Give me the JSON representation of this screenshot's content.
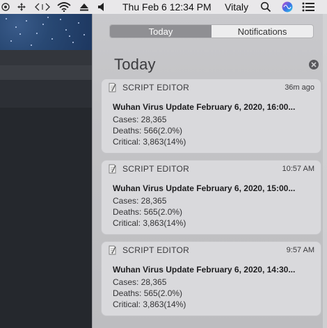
{
  "menubar": {
    "icons": [
      "record-icon",
      "move-icon",
      "code-icon",
      "wifi-icon",
      "eject-icon",
      "volume-icon",
      "search-icon",
      "siri-icon",
      "notification-center-icon"
    ],
    "datetime": "Thu Feb 6  12:34 PM",
    "user": "Vitaly"
  },
  "notification_center": {
    "tabs": [
      {
        "label": "Today",
        "active": true
      },
      {
        "label": "Notifications",
        "active": false
      }
    ],
    "section_title": "Today",
    "notifications": [
      {
        "app": "SCRIPT EDITOR",
        "time": "36m ago",
        "title": "Wuhan Virus Update February 6, 2020, 16:00...",
        "lines": [
          "Cases: 28,365",
          "Deaths: 566(2.0%)",
          "Critical: 3,863(14%)"
        ]
      },
      {
        "app": "SCRIPT EDITOR",
        "time": "10:57 AM",
        "title": "Wuhan Virus Update February 6, 2020, 15:00...",
        "lines": [
          "Cases: 28,365",
          "Deaths: 565(2.0%)",
          "Critical: 3,863(14%)"
        ]
      },
      {
        "app": "SCRIPT EDITOR",
        "time": "9:57 AM",
        "title": "Wuhan Virus Update February 6, 2020, 14:30...",
        "lines": [
          "Cases: 28,365",
          "Deaths: 565(2.0%)",
          "Critical: 3,863(14%)"
        ]
      }
    ]
  },
  "colors": {
    "menubar_bg": "#e9e8ea",
    "panel_bg": "#c6c6c9",
    "active_tab": "#8f8f93",
    "card_bg": "#d9d9dc"
  }
}
